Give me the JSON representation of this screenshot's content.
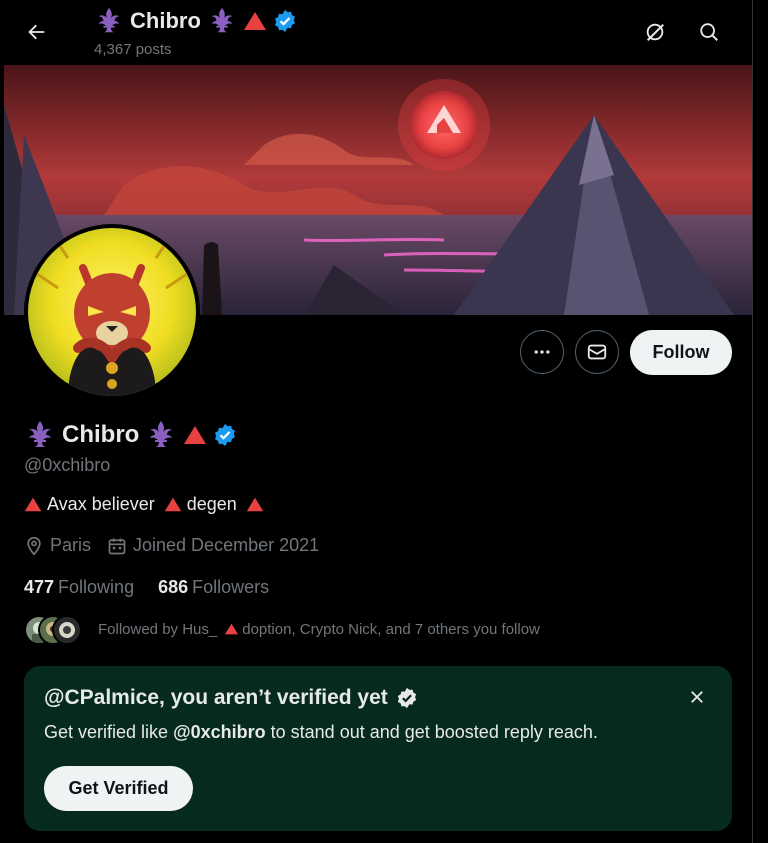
{
  "header": {
    "name": "Chibro",
    "posts_label": "4,367 posts"
  },
  "profile": {
    "name": "Chibro",
    "handle": "@0xchibro",
    "bio_parts": [
      "Avax believer",
      "degen"
    ],
    "location": "Paris",
    "joined": "Joined December 2021",
    "following_count": "477",
    "following_label": "Following",
    "followers_count": "686",
    "followers_label": "Followers",
    "followed_by_prefix": "Followed by Hus_",
    "followed_by_suffix": "doption, Crypto Nick, and 7 others you follow"
  },
  "actions": {
    "follow_label": "Follow"
  },
  "verify_card": {
    "title": "@CPalmice, you aren’t verified yet",
    "desc_before": "Get verified like ",
    "desc_handle": "@0xchibro",
    "desc_after": " to stand out and get boosted reply reach.",
    "button_label": "Get Verified"
  },
  "colors": {
    "avax_red": "#e84142",
    "verified_blue": "#1d9bf0",
    "fleur_purple": "#8b5fbf",
    "card_bg": "#072a1f"
  },
  "icons": [
    "back-arrow-icon",
    "fleur-de-lis-icon",
    "avax-triangle-icon",
    "verified-badge-icon",
    "grok-icon",
    "search-icon",
    "more-icon",
    "message-icon",
    "location-icon",
    "calendar-icon",
    "close-icon"
  ]
}
